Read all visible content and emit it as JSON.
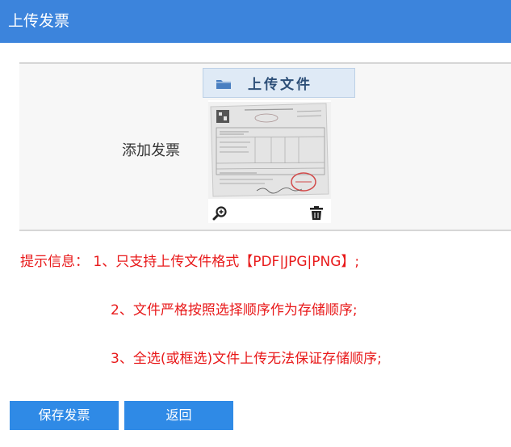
{
  "header": {
    "title": "上传发票"
  },
  "form": {
    "field_label": "添加发票",
    "upload_label": "上传文件",
    "thumbnail": {
      "zoom_icon": "zoom-in-icon",
      "delete_icon": "trash-icon"
    }
  },
  "hints": {
    "line1": "提示信息： 1、只支持上传文件格式【PDF|JPG|PNG】;",
    "line2": "2、文件严格按照选择顺序作为存储顺序;",
    "line3": "3、全选(或框选)文件上传无法保证存储顺序;"
  },
  "buttons": {
    "save": "保存发票",
    "back": "返回"
  },
  "colors": {
    "header_bg": "#3c84dc",
    "button_bg": "#2f8ae6",
    "hint_text": "#e8191a"
  }
}
